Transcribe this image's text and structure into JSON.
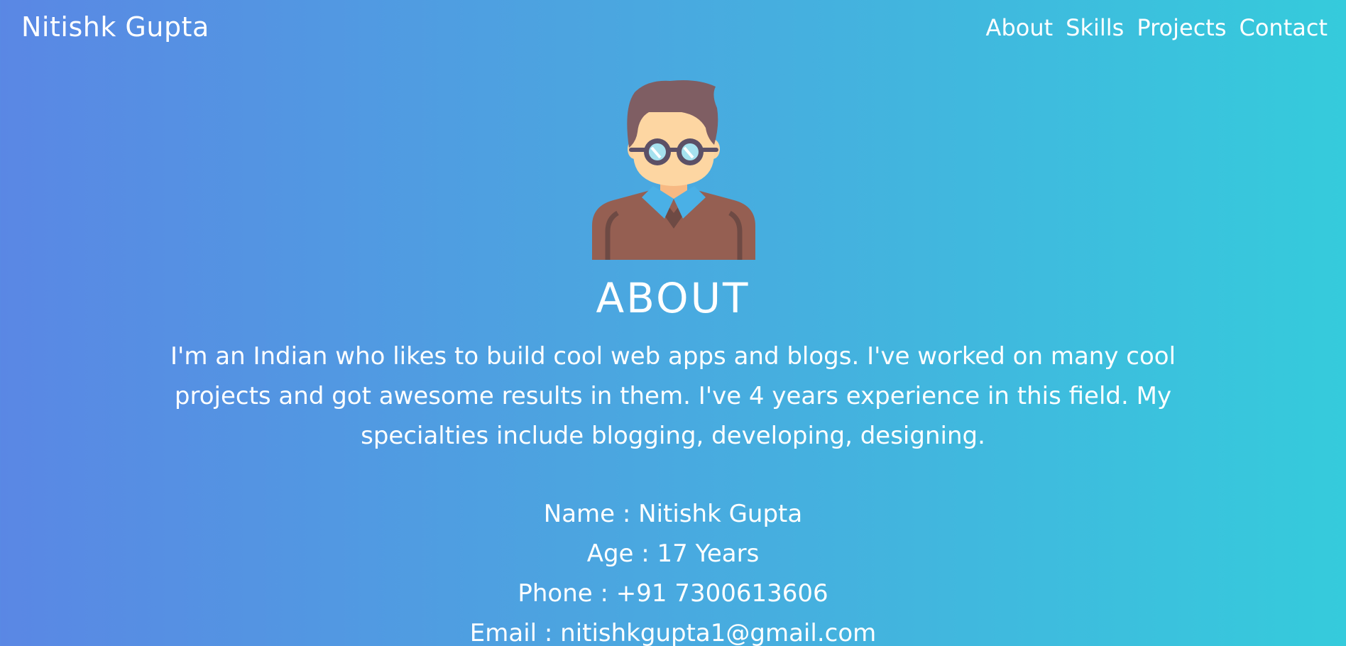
{
  "header": {
    "brand": "Nitishk Gupta",
    "nav": [
      "About",
      "Skills",
      "Projects",
      "Contact"
    ]
  },
  "about": {
    "title": "ABOUT",
    "bio": "I'm an Indian who likes to build cool web apps and blogs. I've worked on many cool projects and got awesome results in them. I've 4 years experience in this field. My specialties include blogging, developing, designing.",
    "details": [
      "Name : Nitishk Gupta",
      "Age : 17 Years",
      "Phone : +91 7300613606",
      "Email : nitishkgupta1@gmail.com"
    ]
  },
  "icons": {
    "avatar": "developer-avatar-icon"
  },
  "colors": {
    "gradient_start": "#5a87e4",
    "gradient_end": "#35cbdc",
    "text": "#ffffff"
  }
}
